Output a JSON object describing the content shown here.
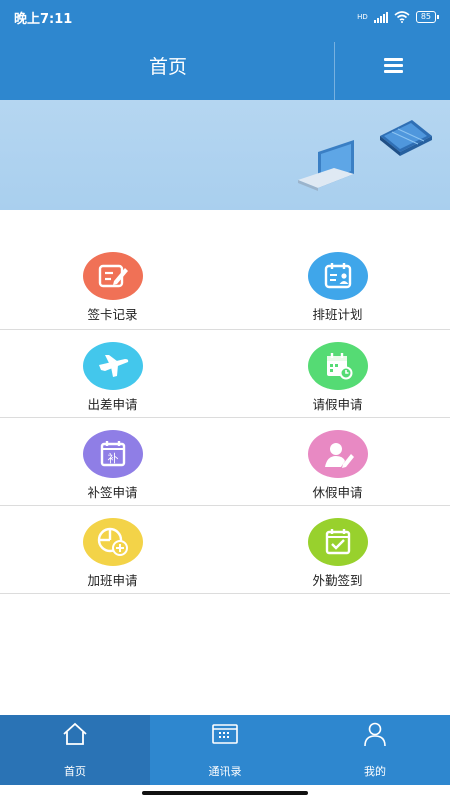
{
  "status_bar": {
    "time": "晚上7:11",
    "network": "HD",
    "battery": "85"
  },
  "header": {
    "title": "首页",
    "menu_icon": "hamburger-menu-icon"
  },
  "colors": {
    "primary": "#2e87cf",
    "nav_active": "#2a73b5",
    "banner": "#b5d6f1"
  },
  "menu": [
    {
      "label": "签卡记录",
      "icon": "edit-note-icon",
      "color": "#f07156"
    },
    {
      "label": "排班计划",
      "icon": "schedule-person-icon",
      "color": "#3fa6ea"
    },
    {
      "label": "出差申请",
      "icon": "airplane-icon",
      "color": "#43c7ec"
    },
    {
      "label": "请假申请",
      "icon": "calendar-clock-icon",
      "color": "#55db74"
    },
    {
      "label": "补签申请",
      "icon": "calendar-supplement-icon",
      "color": "#8f7ee6"
    },
    {
      "label": "休假申请",
      "icon": "person-edit-icon",
      "color": "#e889c3"
    },
    {
      "label": "加班申请",
      "icon": "overtime-add-icon",
      "color": "#f3d348"
    },
    {
      "label": "外勤签到",
      "icon": "calendar-check-icon",
      "color": "#98d12d"
    }
  ],
  "bottom_nav": [
    {
      "label": "首页",
      "icon": "home-icon",
      "active": true
    },
    {
      "label": "通讯录",
      "icon": "contacts-icon",
      "active": false
    },
    {
      "label": "我的",
      "icon": "user-icon",
      "active": false
    }
  ]
}
